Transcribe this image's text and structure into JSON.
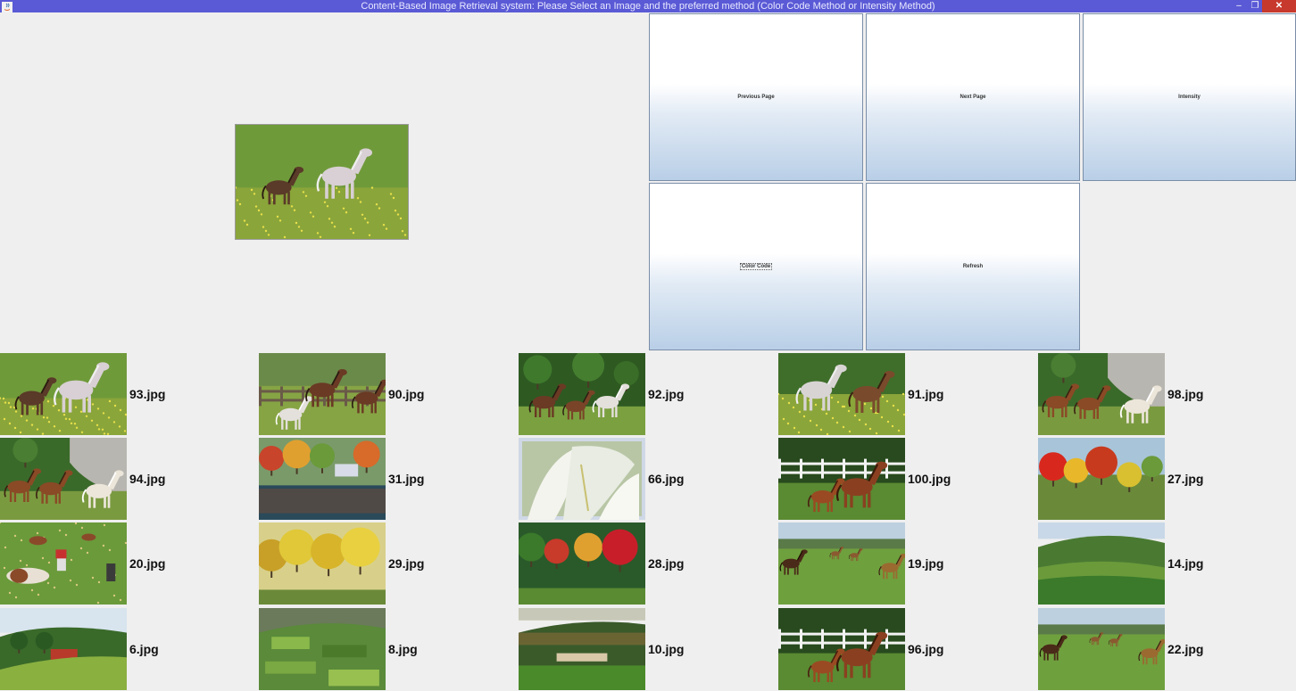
{
  "window": {
    "title": "Content-Based Image Retrieval system: Please Select an Image and the preferred method (Color Code Method or Intensity Method)",
    "controls": {
      "minimize": "–",
      "maximize": "❐",
      "close": "✕"
    }
  },
  "buttons": {
    "previous_page": "Previous Page",
    "next_page": "Next Page",
    "intensity": "Intensity",
    "color_code": "Color Code",
    "refresh": "Refresh"
  },
  "preview": {
    "image": "93.jpg"
  },
  "results": [
    {
      "file": "93.jpg",
      "scene": "horses-meadow"
    },
    {
      "file": "90.jpg",
      "scene": "horses-fence"
    },
    {
      "file": "92.jpg",
      "scene": "horses-trees"
    },
    {
      "file": "91.jpg",
      "scene": "horses-meadow-pair"
    },
    {
      "file": "98.jpg",
      "scene": "horses-rocks"
    },
    {
      "file": "94.jpg",
      "scene": "horses-rocks"
    },
    {
      "file": "31.jpg",
      "scene": "autumn-lake"
    },
    {
      "file": "66.jpg",
      "scene": "white-flower"
    },
    {
      "file": "100.jpg",
      "scene": "horses-fence-white"
    },
    {
      "file": "27.jpg",
      "scene": "autumn-trees"
    },
    {
      "file": "20.jpg",
      "scene": "cows-field"
    },
    {
      "file": "29.jpg",
      "scene": "autumn-yellow"
    },
    {
      "file": "28.jpg",
      "scene": "autumn-red"
    },
    {
      "file": "19.jpg",
      "scene": "horses-field"
    },
    {
      "file": "14.jpg",
      "scene": "green-hills"
    },
    {
      "file": "6.jpg",
      "scene": "village-hills"
    },
    {
      "file": "8.jpg",
      "scene": "patchwork-hills"
    },
    {
      "file": "10.jpg",
      "scene": "hill-farm"
    },
    {
      "file": "96.jpg",
      "scene": "horses-fence-white"
    },
    {
      "file": "22.jpg",
      "scene": "horses-field"
    }
  ],
  "colors": {
    "titlebar": "#5a5ad6",
    "close": "#c7392c",
    "background": "#efefef",
    "button_border": "#7a8ea8"
  }
}
